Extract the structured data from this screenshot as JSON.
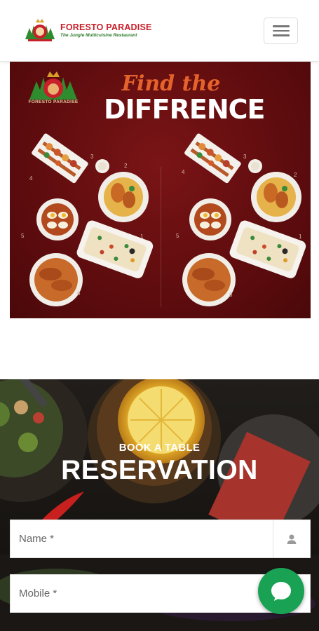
{
  "header": {
    "brand_name": "FORESTO PARADISE",
    "tagline": "The Jungle Multicuisine Restaurant",
    "menu_icon": "hamburger-menu-icon"
  },
  "promo": {
    "logo_text": "FORESTO PARADISE",
    "headline_script": "Find the",
    "headline_main": "DIFFRENCE",
    "dish_numbers": [
      "1",
      "2",
      "3",
      "4",
      "5",
      "6"
    ]
  },
  "reservation": {
    "eyebrow": "BOOK A TABLE",
    "title": "RESERVATION",
    "fields": [
      {
        "placeholder": "Name *",
        "icon": "user-icon"
      },
      {
        "placeholder": "Mobile *",
        "icon": "phone-icon"
      }
    ]
  },
  "chat": {
    "icon": "chat-bubble-icon"
  },
  "colors": {
    "brand_red": "#c8202a",
    "brand_green": "#2a7a2a",
    "promo_bg": "#5a0b0d",
    "accent_orange": "#e5622b",
    "chat_green": "#1aa254"
  }
}
